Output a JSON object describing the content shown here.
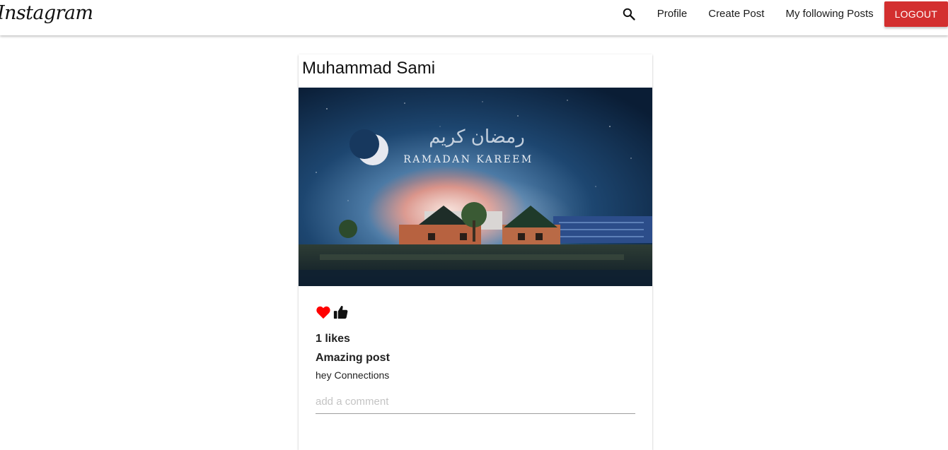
{
  "navbar": {
    "brand": "Instagram",
    "links": {
      "profile": "Profile",
      "create_post": "Create Post",
      "following_posts": "My following Posts"
    },
    "logout_label": "LOGOUT",
    "icons": {
      "search": "search-icon"
    }
  },
  "post": {
    "author": "Muhammad Sami",
    "image": {
      "arabic_text": "رمضان كريم",
      "caption_text": "RAMADAN KAREEM"
    },
    "icons": {
      "like": "heart-icon",
      "thumb": "thumbs-up-icon"
    },
    "likes": "1 likes",
    "title": "Amazing post",
    "body": "hey Connections",
    "comment_placeholder": "add a comment",
    "comment_value": ""
  },
  "colors": {
    "logout": "#d32f2f",
    "heart": "#ff0000",
    "thumb": "#111111",
    "night_sky": "#0d2540"
  }
}
